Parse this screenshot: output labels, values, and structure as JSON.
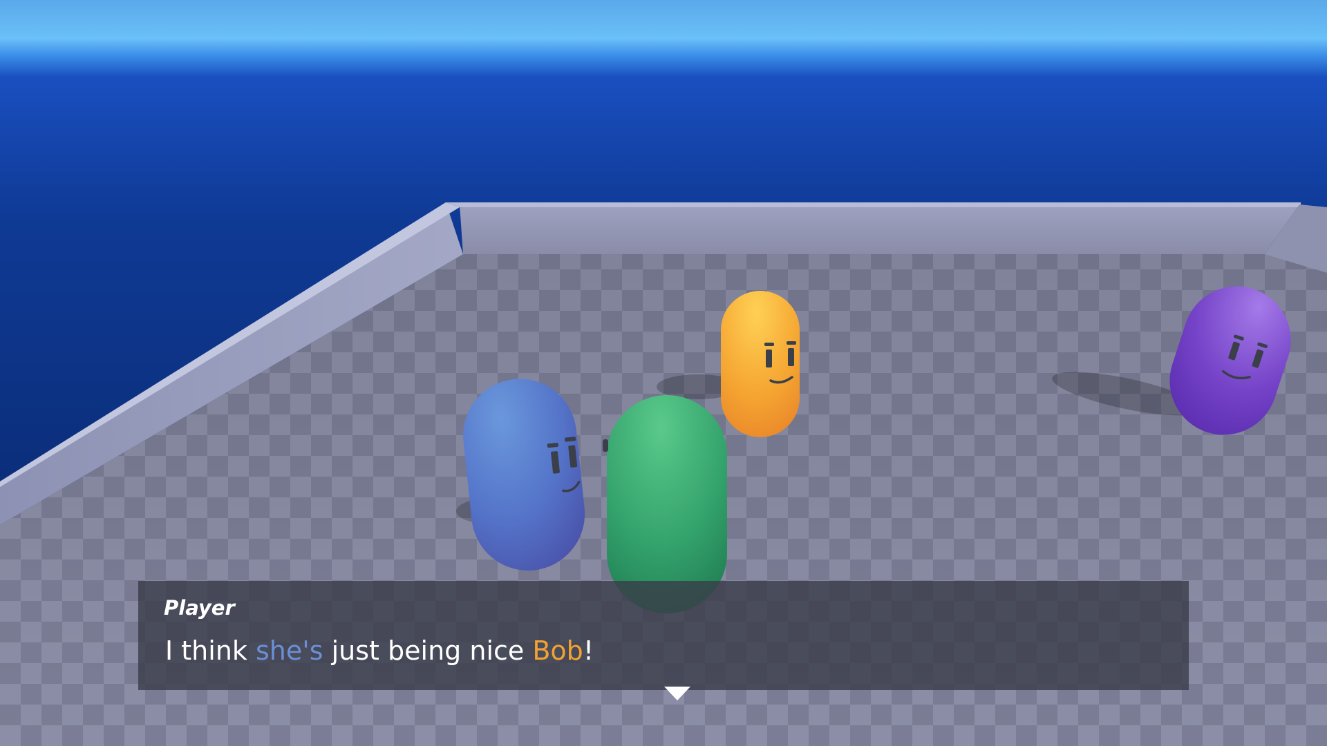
{
  "dialogue": {
    "speaker": "Player",
    "segments": [
      {
        "text": "I think ",
        "color": "#ffffff"
      },
      {
        "text": "she's",
        "color": "#6b8fd6"
      },
      {
        "text": " just being nice ",
        "color": "#ffffff"
      },
      {
        "text": "Bob",
        "color": "#f0a232"
      },
      {
        "text": "!",
        "color": "#ffffff"
      }
    ],
    "continue_icon": "triangle-down-icon"
  },
  "scene": {
    "sky_colors": [
      "#66bdf7",
      "#1a4fc0",
      "#0d2f85"
    ],
    "floor_colors": [
      "#7a7d96",
      "#8d90a8"
    ],
    "characters": [
      {
        "name": "blue-pill",
        "color": "#5a7fd0"
      },
      {
        "name": "green-pill",
        "color": "#3ab07a"
      },
      {
        "name": "orange-pill",
        "color": "#f5a531"
      },
      {
        "name": "purple-pill",
        "color": "#7a46cc"
      }
    ]
  }
}
